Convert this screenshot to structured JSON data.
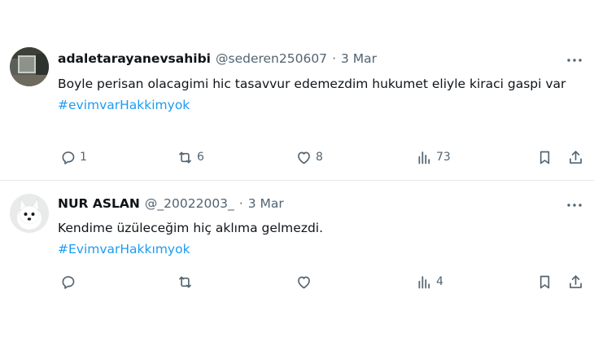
{
  "tweets": [
    {
      "name": "adaletarayanevsahibi",
      "handle": "@sederen250607",
      "dot": "·",
      "date": "3 Mar",
      "text": "Boyle perisan olacagimi hic tasavvur edemezdim hukumet eliyle kiraci gaspi var",
      "hashtag": "#evimvarHakkimyok",
      "replies": "1",
      "retweets": "6",
      "likes": "8",
      "views": "73"
    },
    {
      "name": "NUR ASLAN",
      "handle": "@_20022003_",
      "dot": "·",
      "date": "3 Mar",
      "text": "Kendime üzüleceğim hiç aklıma gelmezdi.",
      "hashtag": "#EvimvarHakkımyok",
      "replies": "",
      "retweets": "",
      "likes": "",
      "views": "4"
    }
  ],
  "icons": [
    "reply-icon",
    "retweet-icon",
    "like-icon",
    "views-icon",
    "bookmark-icon",
    "share-icon",
    "more-icon"
  ],
  "colors": {
    "hashtag": "#1d9bf0",
    "secondary": "#536471",
    "text": "#0f1419"
  }
}
